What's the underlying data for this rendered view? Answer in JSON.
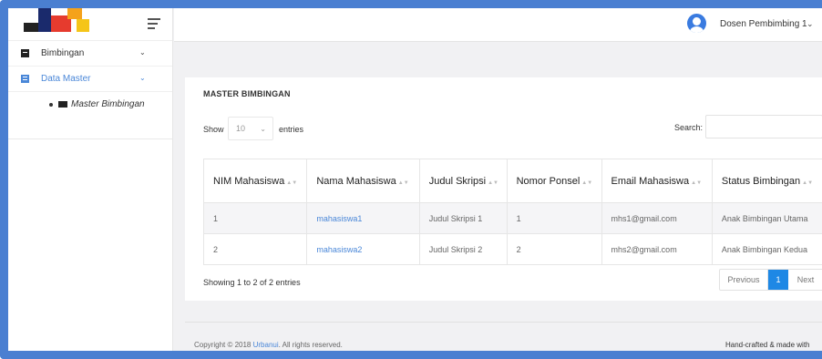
{
  "topbar": {
    "user_name": "Dosen Pembimbing 1"
  },
  "sidebar": {
    "items": [
      {
        "label": "Bimbingan"
      },
      {
        "label": "Data Master"
      }
    ],
    "sub_items": [
      {
        "label": "Master Bimbingan"
      }
    ]
  },
  "card": {
    "title": "MASTER BIMBINGAN",
    "show_label": "Show",
    "page_length": "10",
    "entries_label": "entries",
    "search_label": "Search:",
    "search_value": ""
  },
  "table": {
    "columns": [
      "NIM Mahasiswa",
      "Nama Mahasiswa",
      "Judul Skripsi",
      "Nomor Ponsel",
      "Email Mahasiswa",
      "Status Bimbingan"
    ],
    "rows": [
      {
        "nim": "1",
        "nama": "mahasiswa1",
        "judul": "Judul Skripsi 1",
        "ponsel": "1",
        "email": "mhs1@gmail.com",
        "status": "Anak Bimbingan Utama"
      },
      {
        "nim": "2",
        "nama": "mahasiswa2",
        "judul": "Judul Skripsi 2",
        "ponsel": "2",
        "email": "mhs2@gmail.com",
        "status": "Anak Bimbingan Kedua"
      }
    ],
    "info": "Showing 1 to 2 of 2 entries"
  },
  "pagination": {
    "previous": "Previous",
    "current": "1",
    "next": "Next"
  },
  "footer": {
    "copyright_prefix": "Copyright © 2018 ",
    "brand": "Urbanui",
    "copyright_suffix": ". All rights reserved.",
    "right_text": "Hand-crafted & made with"
  },
  "colors": {
    "frame_border": "#4a7fd1",
    "accent": "#4a87d8",
    "page_active": "#1e88e5",
    "user_icon": "#3a7be0"
  },
  "icons": {
    "hamburger": "menu-icon",
    "user": "user-circle-icon",
    "bimbingan": "book-icon",
    "data_master": "database-icon",
    "sub_item": "folder-icon"
  }
}
